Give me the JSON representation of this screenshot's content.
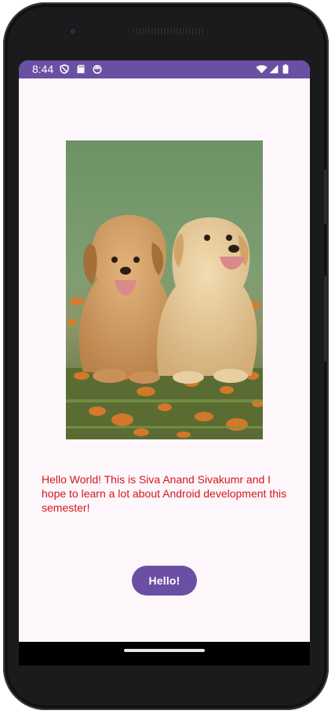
{
  "status_bar": {
    "time": "8:44",
    "left_icons": [
      "shield-icon",
      "sd-card-icon",
      "android-robot-icon"
    ],
    "right_icons": [
      "wifi-icon",
      "cell-signal-icon",
      "battery-icon"
    ],
    "background": "#6a4fa3"
  },
  "main": {
    "image_label": "Two golden retriever puppies sitting in grass with orange leaves",
    "message": "Hello World! This is Siva Anand Sivakumr and I hope to learn a lot about Android development this semester!",
    "message_color": "#d4161b",
    "button_label": "Hello!",
    "button_color": "#6a4fa3"
  }
}
